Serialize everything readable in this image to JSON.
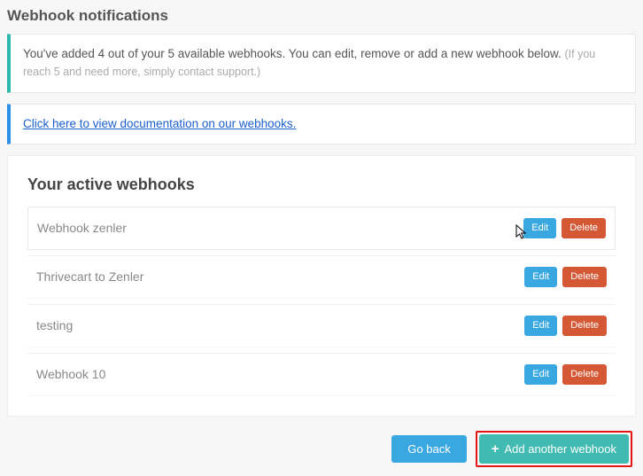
{
  "page_title": "Webhook notifications",
  "alert": {
    "text": "You've added 4 out of your 5 available webhooks. You can edit, remove or add a new webhook below. ",
    "muted": "(If you reach 5 and need more, simply contact support.)"
  },
  "doc_link": {
    "text": "Click here to view documentation on our webhooks."
  },
  "panel": {
    "title": "Your active webhooks",
    "edit_label": "Edit",
    "delete_label": "Delete",
    "webhooks": [
      {
        "name": "Webhook zenler"
      },
      {
        "name": "Thrivecart to Zenler"
      },
      {
        "name": "testing"
      },
      {
        "name": "Webhook 10"
      }
    ]
  },
  "footer": {
    "go_back": "Go back",
    "add_another": "Add another webhook"
  }
}
